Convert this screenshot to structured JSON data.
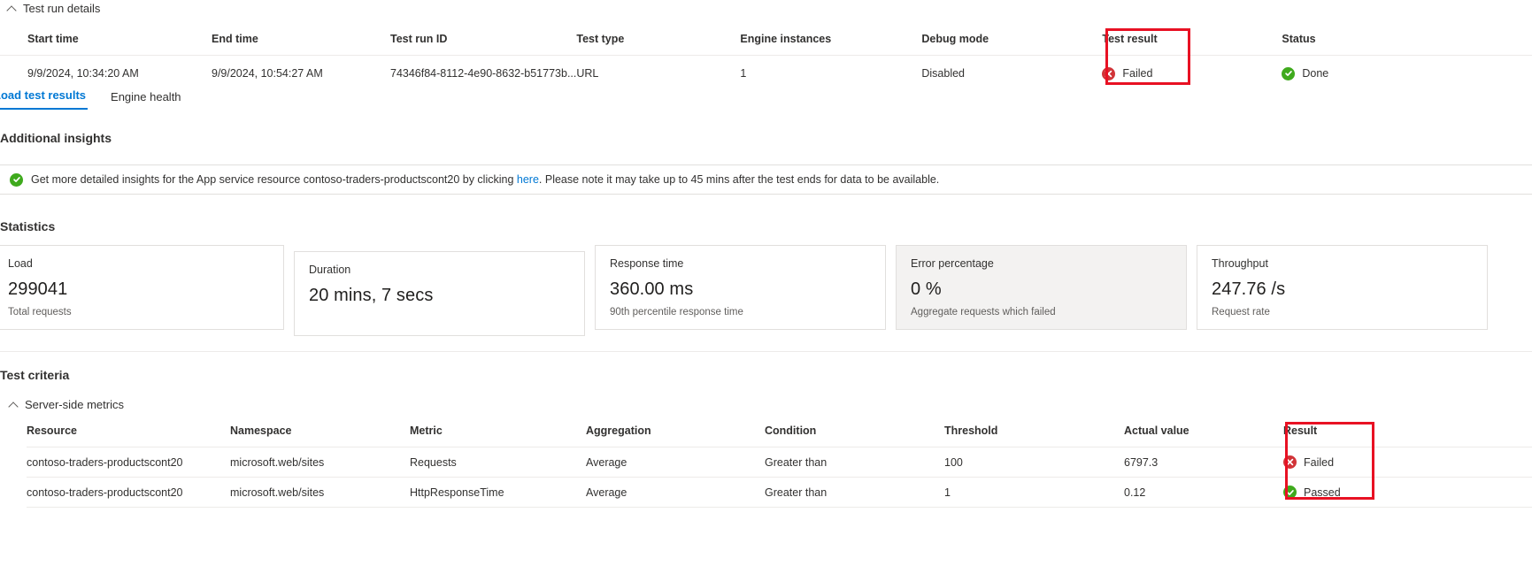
{
  "details": {
    "section_title": "Test run details",
    "columns": [
      "Start time",
      "End time",
      "Test run ID",
      "Test type",
      "Engine instances",
      "Debug mode",
      "Test result",
      "Status"
    ],
    "row": {
      "start_time": "9/9/2024, 10:34:20 AM",
      "end_time": "9/9/2024, 10:54:27 AM",
      "test_run_id": "74346f84-8112-4e90-8632-b51773b...",
      "test_type": "URL",
      "engine_instances": "1",
      "debug_mode": "Disabled",
      "test_result": "Failed",
      "status": "Done"
    }
  },
  "tabs": [
    {
      "label": "Load test results",
      "active": true
    },
    {
      "label": "Engine health",
      "active": false
    }
  ],
  "insights": {
    "title": "Additional insights",
    "message_before_link": "Get more detailed insights for the App service resource contoso-traders-productscont20 by clicking ",
    "link_text": "here",
    "message_after_link": ". Please note it may take up to 45 mins after the test ends for data to be available."
  },
  "statistics": {
    "title": "Statistics",
    "cards": [
      {
        "label": "Load",
        "value": "299041",
        "sub": "Total requests",
        "hover": false
      },
      {
        "label": "Duration",
        "value": "20 mins, 7 secs",
        "sub": "",
        "hover": false
      },
      {
        "label": "Response time",
        "value": "360.00 ms",
        "sub": "90th percentile response time",
        "hover": false
      },
      {
        "label": "Error percentage",
        "value": "0 %",
        "sub": "Aggregate requests which failed",
        "hover": true
      },
      {
        "label": "Throughput",
        "value": "247.76 /s",
        "sub": "Request rate",
        "hover": false
      }
    ]
  },
  "criteria": {
    "title": "Test criteria",
    "group_label": "Server-side metrics",
    "columns": [
      "Resource",
      "Namespace",
      "Metric",
      "Aggregation",
      "Condition",
      "Threshold",
      "Actual value",
      "Result"
    ],
    "rows": [
      {
        "resource": "contoso-traders-productscont20",
        "namespace": "microsoft.web/sites",
        "metric": "Requests",
        "aggregation": "Average",
        "condition": "Greater than",
        "threshold": "100",
        "actual_value": "6797.3",
        "result": "Failed",
        "result_state": "fail"
      },
      {
        "resource": "contoso-traders-productscont20",
        "namespace": "microsoft.web/sites",
        "metric": "HttpResponseTime",
        "aggregation": "Average",
        "condition": "Greater than",
        "threshold": "1",
        "actual_value": "0.12",
        "result": "Passed",
        "result_state": "pass"
      }
    ]
  },
  "colors": {
    "accent": "#0078d4",
    "fail": "#d13438",
    "pass": "#3faa1d",
    "callout": "#e81123"
  }
}
